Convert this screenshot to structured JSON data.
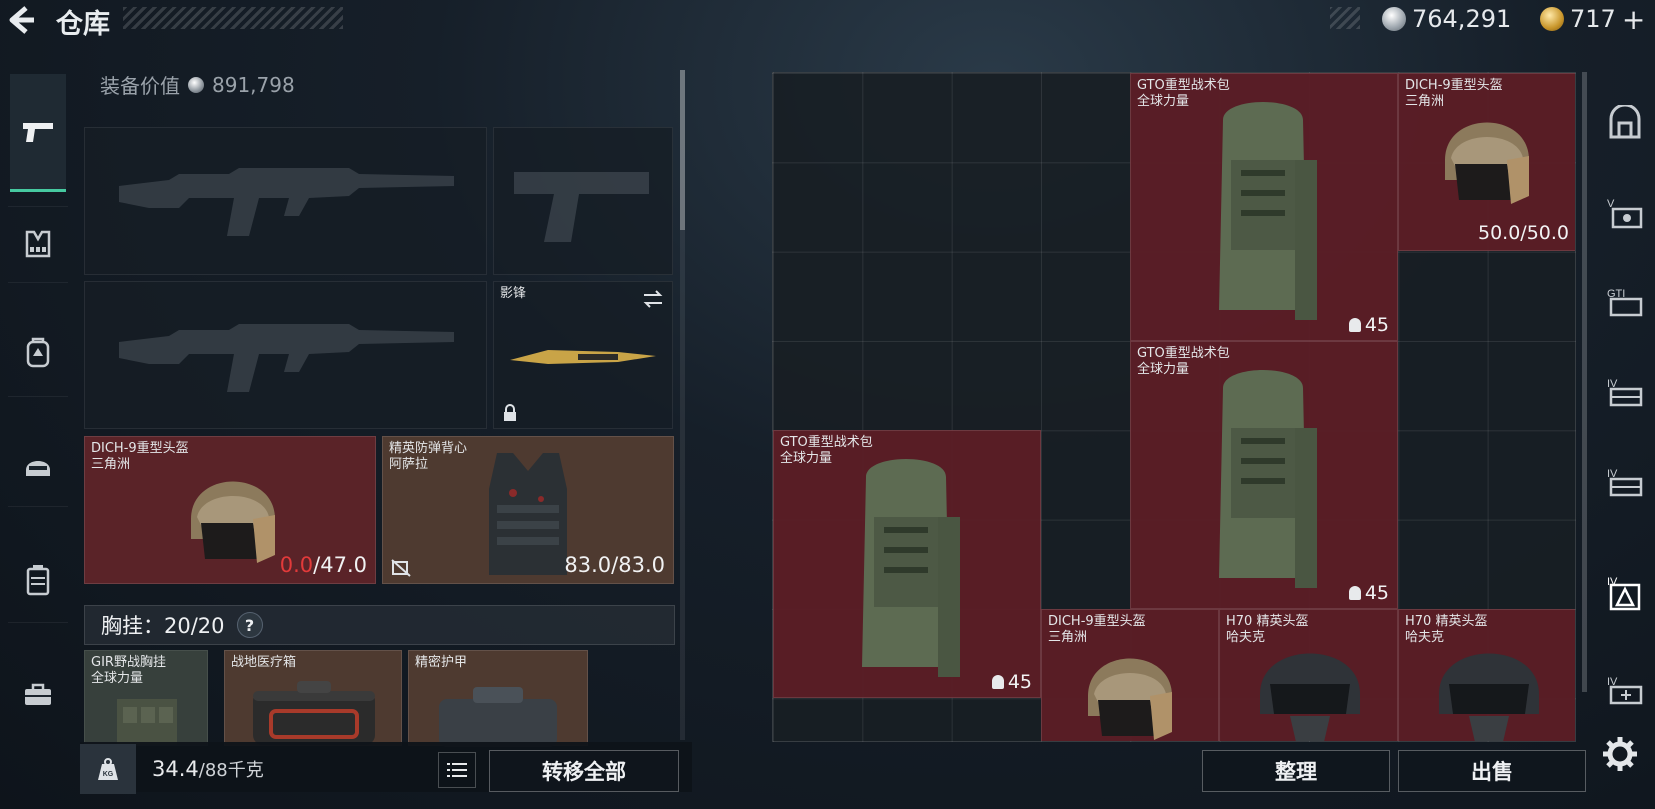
{
  "header": {
    "title": "仓库",
    "silver_amount": "764,291",
    "gold_amount": "717",
    "add_label": "+"
  },
  "sidebar": {
    "items": [
      {
        "name": "weapons",
        "icon": "pistol-icon",
        "active": true
      },
      {
        "name": "chest-rig",
        "icon": "vest-icon",
        "active": false
      },
      {
        "name": "backpack",
        "icon": "backpack-icon",
        "active": false
      },
      {
        "name": "gear",
        "icon": "helmet-icon",
        "active": false
      },
      {
        "name": "supplies",
        "icon": "canister-icon",
        "active": false
      },
      {
        "name": "toolbox",
        "icon": "toolbox-icon",
        "active": false
      }
    ]
  },
  "loadout": {
    "equip_value_label": "装备价值",
    "equip_value": "891,798",
    "melee": {
      "title": "影锋"
    },
    "helmet": {
      "title": "DICH-9重型头盔",
      "subtitle": "三角洲",
      "current": "0.0",
      "max": "/47.0"
    },
    "armor": {
      "title": "精英防弹背心",
      "subtitle": "阿萨拉",
      "durability": "83.0/83.0"
    },
    "chest_rig": {
      "label": "胸挂：20/20",
      "help": "?"
    },
    "rig_slots": [
      {
        "title": "GIR野战胸挂",
        "subtitle": "全球力量"
      },
      {
        "title": "战地医疗箱",
        "subtitle": ""
      },
      {
        "title": "精密护甲",
        "subtitle": ""
      }
    ]
  },
  "footer": {
    "kg_icon_text": "KG",
    "weight_current": "34.4",
    "weight_max": "/88千克",
    "transfer_all": "转移全部",
    "organize": "整理",
    "sell": "出售"
  },
  "storage": {
    "items": [
      {
        "title": "GTO重型战术包",
        "subtitle": "全球力量",
        "count": "45"
      },
      {
        "title": "DICH-9重型头盔",
        "subtitle": "三角洲",
        "durability": "50.0/50.0"
      },
      {
        "title": "GTO重型战术包",
        "subtitle": "全球力量",
        "count": "45"
      },
      {
        "title": "GTO重型战术包",
        "subtitle": "全球力量",
        "count": "45"
      },
      {
        "title": "DICH-9重型头盔",
        "subtitle": "三角洲"
      },
      {
        "title": "H70 精英头盔",
        "subtitle": "哈夫克"
      },
      {
        "title": "H70 精英头盔",
        "subtitle": "哈夫克"
      }
    ]
  },
  "right_sidebar": {
    "items": [
      {
        "label": "",
        "icon": "safe-box-icon"
      },
      {
        "label": "V",
        "icon": "case-v-icon"
      },
      {
        "label": "GTI",
        "icon": "gti-icon"
      },
      {
        "label": "IV",
        "icon": "case-iv-icon"
      },
      {
        "label": "IV",
        "icon": "case-iv-2-icon"
      },
      {
        "label": "IV",
        "icon": "case-iv-active-icon"
      },
      {
        "label": "IV",
        "icon": "case-iv-add-icon"
      }
    ]
  },
  "colors": {
    "accent": "#46c9a0",
    "red_slot": "#5a2328",
    "brown_slot": "#4e3a30",
    "warning": "#e23a3a"
  }
}
